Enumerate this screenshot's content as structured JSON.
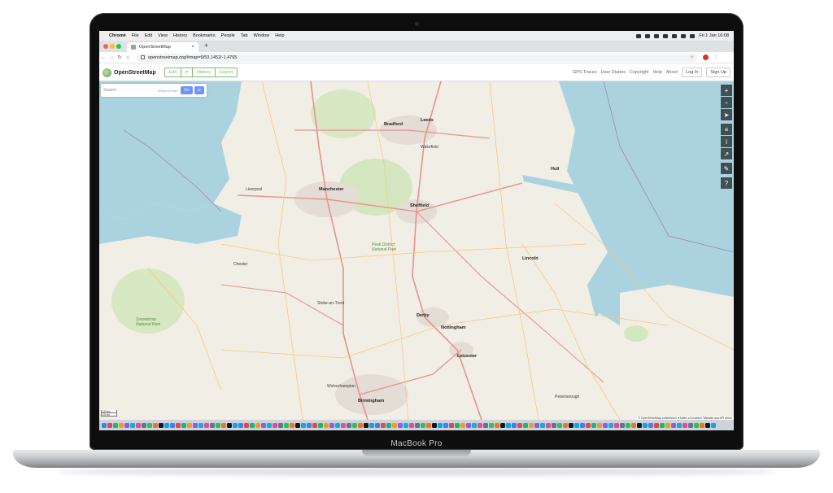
{
  "device": {
    "label": "MacBook Pro"
  },
  "menubar": {
    "app": "Chrome",
    "items": [
      "File",
      "Edit",
      "View",
      "History",
      "Bookmarks",
      "People",
      "Tab",
      "Window",
      "Help"
    ],
    "clock": "Fri 1 Jan 16:08"
  },
  "browser": {
    "tab_title": "OpenStreetMap",
    "url": "openstreetmap.org/#map=9/53.1452/-1.4765"
  },
  "osm": {
    "brand": "OpenStreetMap",
    "edit_label": "Edit",
    "history_label": "History",
    "export_label": "Export",
    "nav": {
      "gps": "GPS Traces",
      "diaries": "User Diaries",
      "copyright": "Copyright",
      "help": "Help",
      "about": "About",
      "login": "Log In",
      "signup": "Sign Up"
    },
    "search": {
      "placeholder": "Search",
      "where": "Where is this?",
      "go": "Go"
    },
    "scale": {
      "km": "10 km",
      "mi": "10 mi"
    },
    "attribution": "© OpenStreetMap contributors ♥ Make a Donation. Website and API terms"
  },
  "map": {
    "places": {
      "manchester": "Manchester",
      "sheffield": "Sheffield",
      "leeds": "Leeds",
      "bradford": "Bradford",
      "wakefield": "Wakefield",
      "derby": "Derby",
      "nottingham": "Nottingham",
      "leicester": "Leicester",
      "stoke": "Stoke-on-Trent",
      "birmingham": "Birmingham",
      "wolverhampton": "Wolverhampton",
      "lincoln": "Lincoln",
      "peterborough": "Peterborough",
      "chester": "Chester",
      "liverpool": "Liverpool",
      "hull": "Hull",
      "peak": "Peak District National Park",
      "snowdonia": "Snowdonia National Park"
    }
  },
  "colors": {
    "land": "#f1eee6",
    "sea": "#aad3df",
    "green": "#cde4b5",
    "urban": "#e3ddd5",
    "road_major": "#e8928c",
    "road_minor": "#f7c97b",
    "osm_green": "#7ebc6f",
    "accent_blue": "#7092ff"
  }
}
